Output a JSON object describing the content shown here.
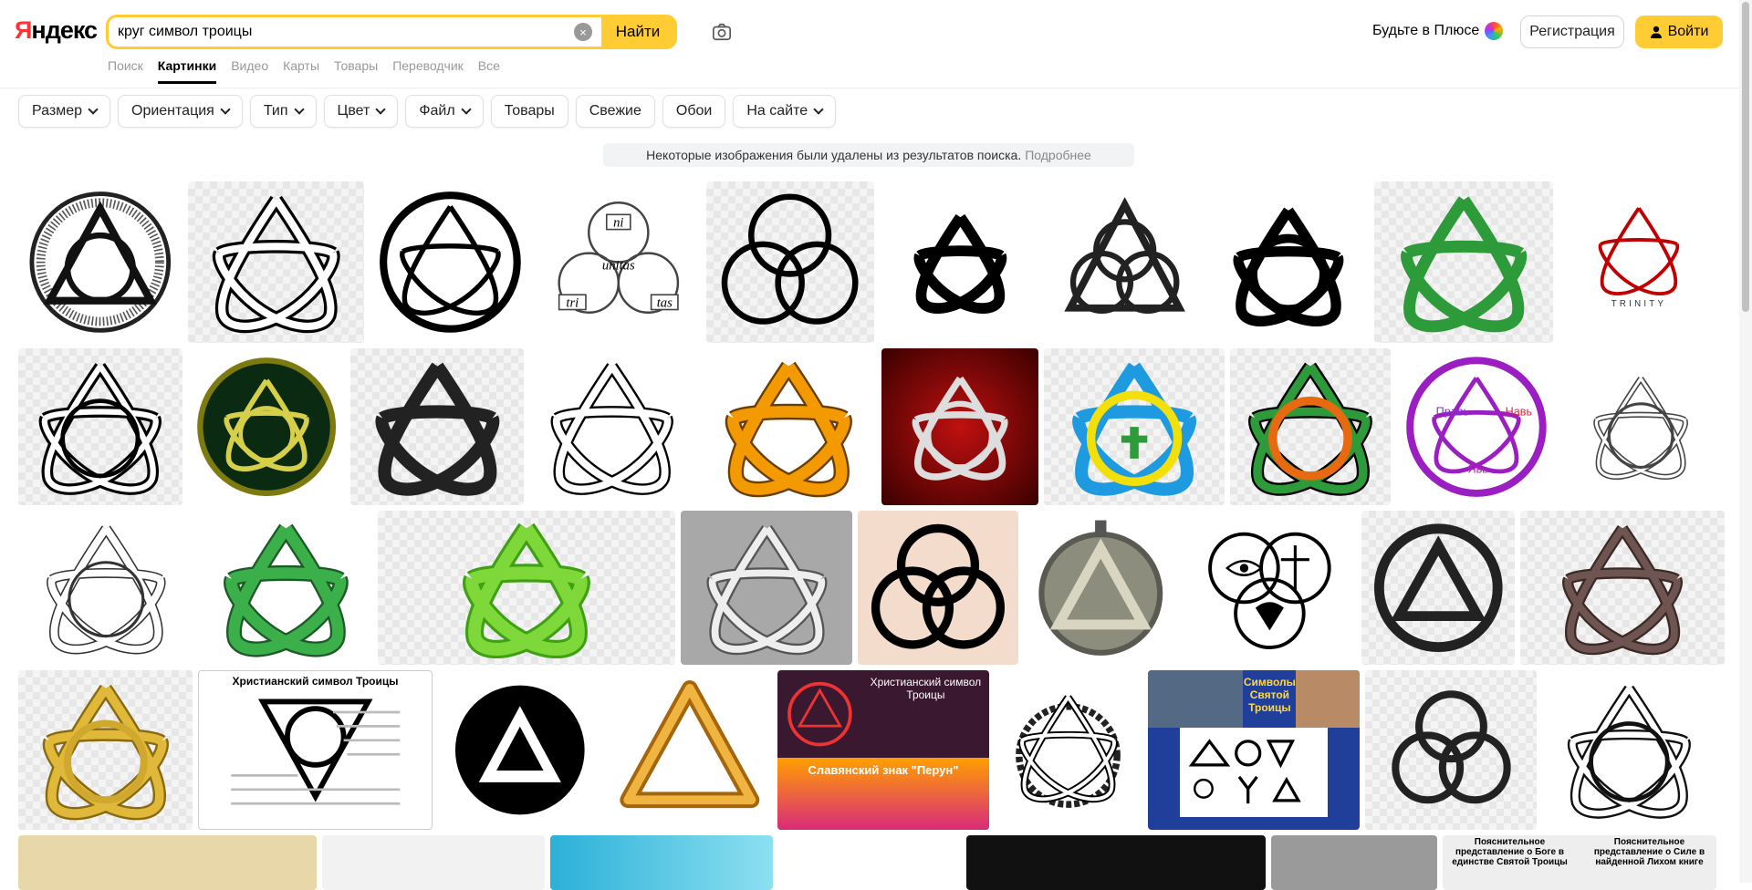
{
  "logo": {
    "text_y": "Я",
    "text_rest": "ндекс"
  },
  "search": {
    "query": "круг символ троицы",
    "clear": "×",
    "find_label": "Найти"
  },
  "header": {
    "plus_label": "Будьте в Плюсе",
    "register_label": "Регистрация",
    "login_label": "Войти"
  },
  "tabs": [
    {
      "label": "Поиск"
    },
    {
      "label": "Картинки"
    },
    {
      "label": "Видео"
    },
    {
      "label": "Карты"
    },
    {
      "label": "Товары"
    },
    {
      "label": "Переводчик"
    },
    {
      "label": "Все"
    }
  ],
  "filters": [
    {
      "label": "Размер"
    },
    {
      "label": "Ориентация"
    },
    {
      "label": "Тип"
    },
    {
      "label": "Цвет"
    },
    {
      "label": "Файл"
    },
    {
      "label": "Товары"
    },
    {
      "label": "Свежие"
    },
    {
      "label": "Обои"
    },
    {
      "label": "На сайте"
    }
  ],
  "notice": {
    "text": "Некоторые изображения были удалены из результатов поиска.",
    "link": "Подробнее"
  },
  "tile_text": {
    "ni": "ni",
    "tri": "tri",
    "unitas": "unitas",
    "tas": "tas",
    "trinity": "TRINITY",
    "prav": "Правь",
    "nav": "Навь",
    "yav": "Явь",
    "christ_title": "Христианский символ Троицы",
    "christ_title2": "Христианский символ Троицы",
    "perun": "Славянский знак \"Перун\"",
    "symbols": "Символы Святой Троицы",
    "concept1": "Пояснительное представление о Боге в единстве Святой Троицы",
    "concept2": "Пояснительное представление о Силе в найденной Лихом книге"
  },
  "colors": {
    "accent": "#ffcc33",
    "green": "#2e9b3a",
    "red": "#c00000",
    "orange": "#f39a00"
  }
}
